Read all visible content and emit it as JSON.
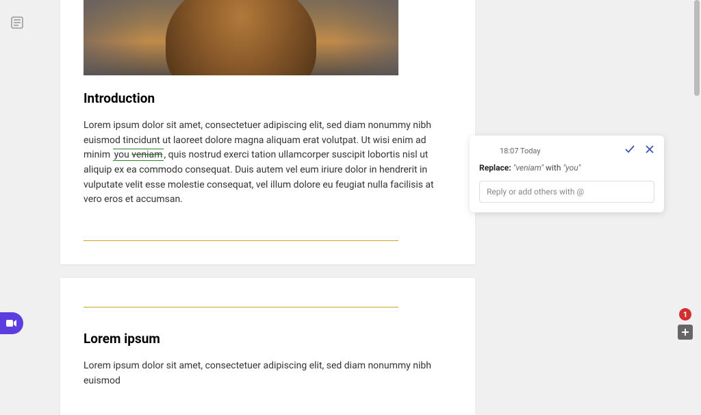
{
  "sidebar": {
    "icon": "outline-icon"
  },
  "document": {
    "page1": {
      "heading": "Introduction",
      "paragraph_pre": "Lorem ipsum dolor sit amet, consectetuer adipiscing elit, sed diam nonummy nibh euismod tincidunt ut laoreet dolore magna aliquam erat volutpat. Ut wisi enim ad minim ",
      "tracked_insert": "you",
      "tracked_delete": "veniam",
      "paragraph_post": ", quis nostrud exerci tation ullamcorper suscipit lobortis nisl ut aliquip ex ea commodo consequat. Duis autem vel eum iriure dolor in hendrerit in vulputate velit esse molestie consequat, vel illum dolore eu feugiat nulla facilisis at vero eros et accumsan."
    },
    "page2": {
      "heading": "Lorem ipsum",
      "paragraph_partial": "Lorem ipsum dolor sit amet, consectetuer adipiscing elit, sed diam nonummy nibh euismod"
    }
  },
  "suggestion": {
    "timestamp": "18:07 Today",
    "action_label": "Replace:",
    "old_text": "\"veniam\"",
    "connector": " with ",
    "new_text": "\"you\"",
    "reply_placeholder": "Reply or add others with @"
  },
  "notifications": {
    "count": "1"
  }
}
